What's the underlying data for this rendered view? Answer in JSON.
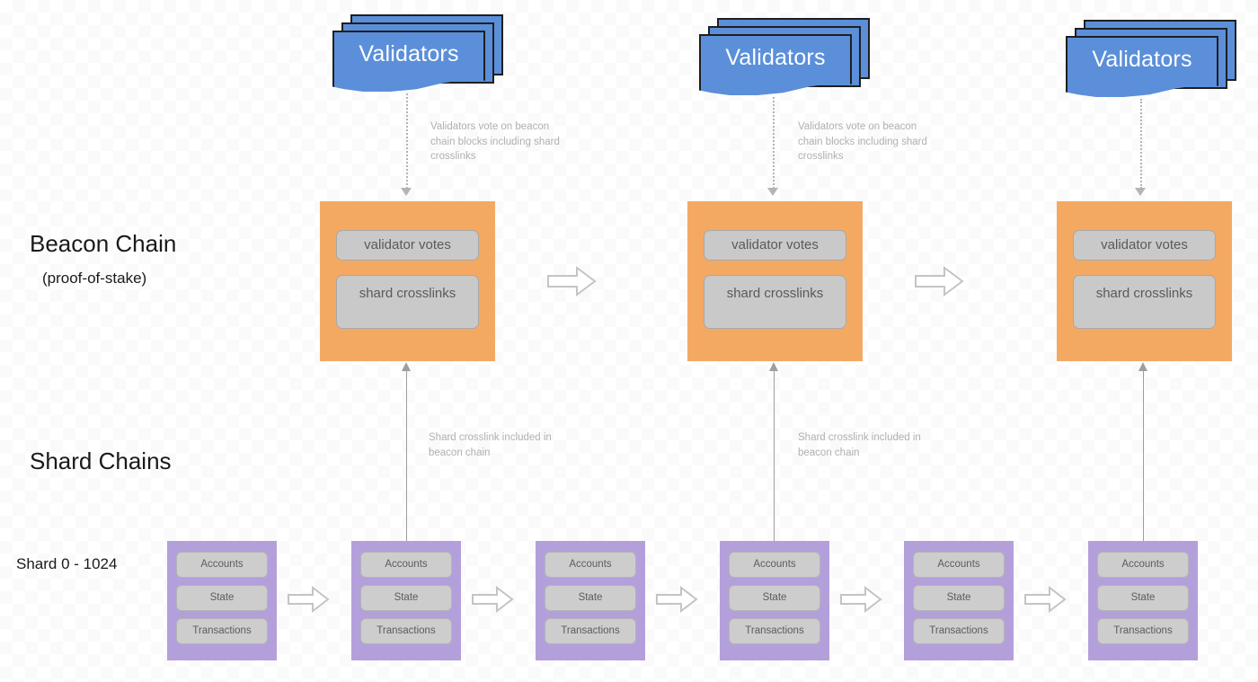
{
  "labels": {
    "beacon_chain_title": "Beacon Chain",
    "beacon_chain_subtitle": "(proof-of-stake)",
    "shard_chains_title": "Shard Chains",
    "shard_range": "Shard 0 - 1024"
  },
  "validators": [
    {
      "label": "Validators"
    },
    {
      "label": "Validators"
    },
    {
      "label": "Validators"
    }
  ],
  "annotations": {
    "vote": "Validators vote on beacon chain blocks including shard crosslinks",
    "crosslink": "Shard crosslink included in beacon chain"
  },
  "beacon_blocks": [
    {
      "votes": "validator votes",
      "crosslinks": "shard crosslinks"
    },
    {
      "votes": "validator votes",
      "crosslinks": "shard crosslinks"
    },
    {
      "votes": "validator votes",
      "crosslinks": "shard crosslinks"
    }
  ],
  "shard_blocks": [
    {
      "accounts": "Accounts",
      "state": "State",
      "transactions": "Transactions"
    },
    {
      "accounts": "Accounts",
      "state": "State",
      "transactions": "Transactions"
    },
    {
      "accounts": "Accounts",
      "state": "State",
      "transactions": "Transactions"
    },
    {
      "accounts": "Accounts",
      "state": "State",
      "transactions": "Transactions"
    },
    {
      "accounts": "Accounts",
      "state": "State",
      "transactions": "Transactions"
    },
    {
      "accounts": "Accounts",
      "state": "State",
      "transactions": "Transactions"
    }
  ],
  "colors": {
    "beacon_block": "#f4a963",
    "shard_block": "#b3a0db",
    "validators_card": "#5b8fd9",
    "inner_pill": "#c9c9c9",
    "annotation_text": "#b0b0b0",
    "arrow_stroke": "#9e9e9e",
    "background": "#ffffff"
  }
}
